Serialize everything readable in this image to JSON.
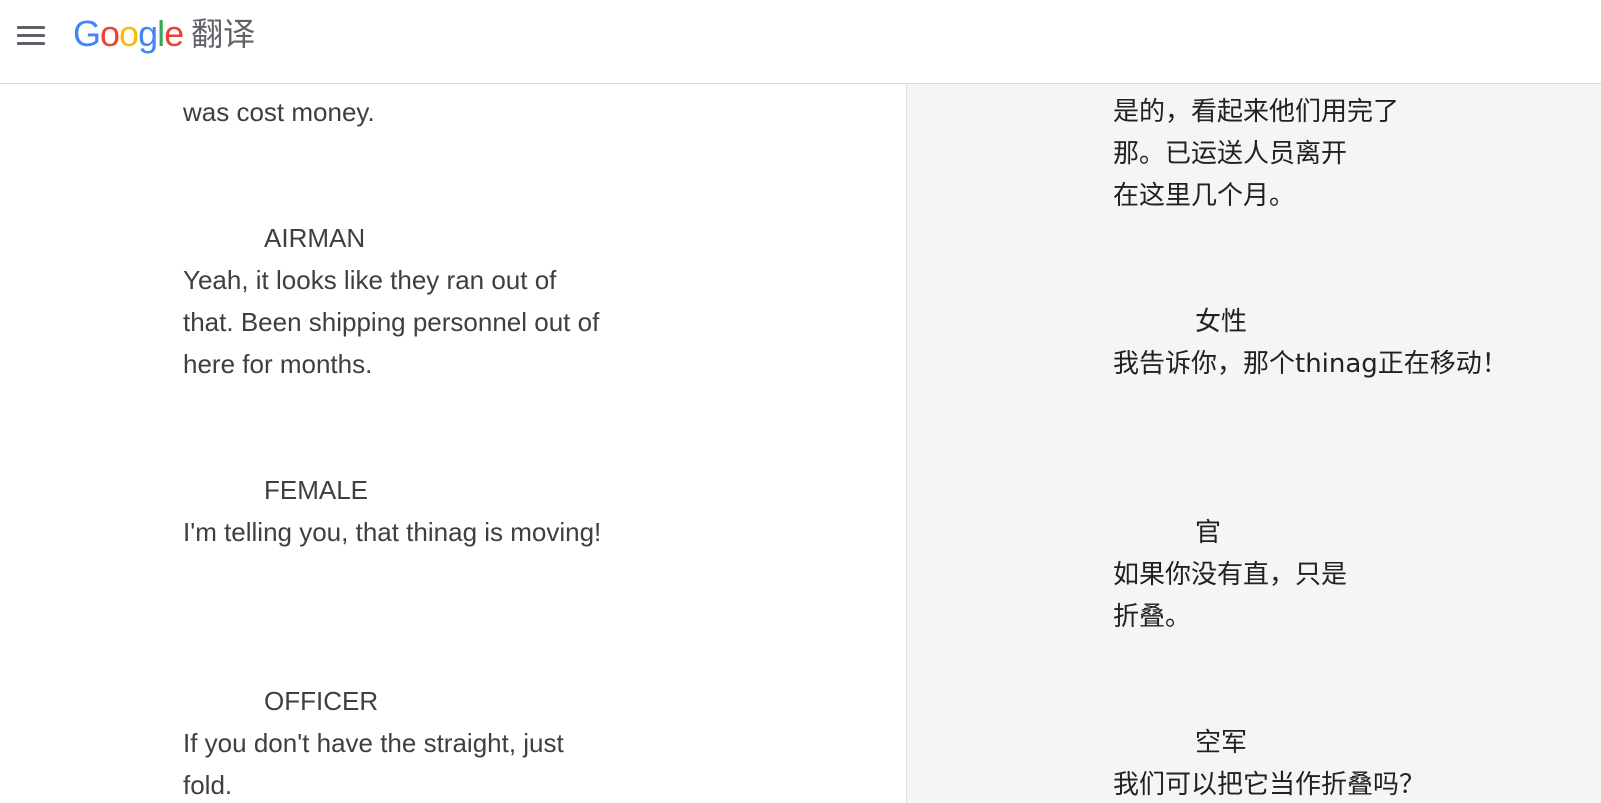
{
  "header": {
    "logo_letters": [
      "G",
      "o",
      "o",
      "g",
      "l",
      "e"
    ],
    "product_name": "翻译"
  },
  "source": {
    "lines": [
      "was cost money.",
      "AIRMAN",
      "Yeah, it looks like they ran out of",
      "that. Been shipping personnel out of",
      "here for months.",
      "FEMALE",
      "I'm telling you, that thinag is moving!",
      "OFFICER",
      "If you don't have the straight, just",
      "fold."
    ]
  },
  "translation": {
    "lines": [
      "是的，看起来他们用完了",
      "那。已运送人员离开",
      "在这里几个月。",
      "女性",
      "我告诉你，那个thinag正在移动！",
      "官",
      "如果你没有直，只是",
      "折叠。",
      "空军",
      "我们可以把它当作折叠吗？"
    ]
  },
  "colors": {
    "text": "#3c4043",
    "translation_bg": "#f5f5f5",
    "divider": "#dadce0"
  }
}
